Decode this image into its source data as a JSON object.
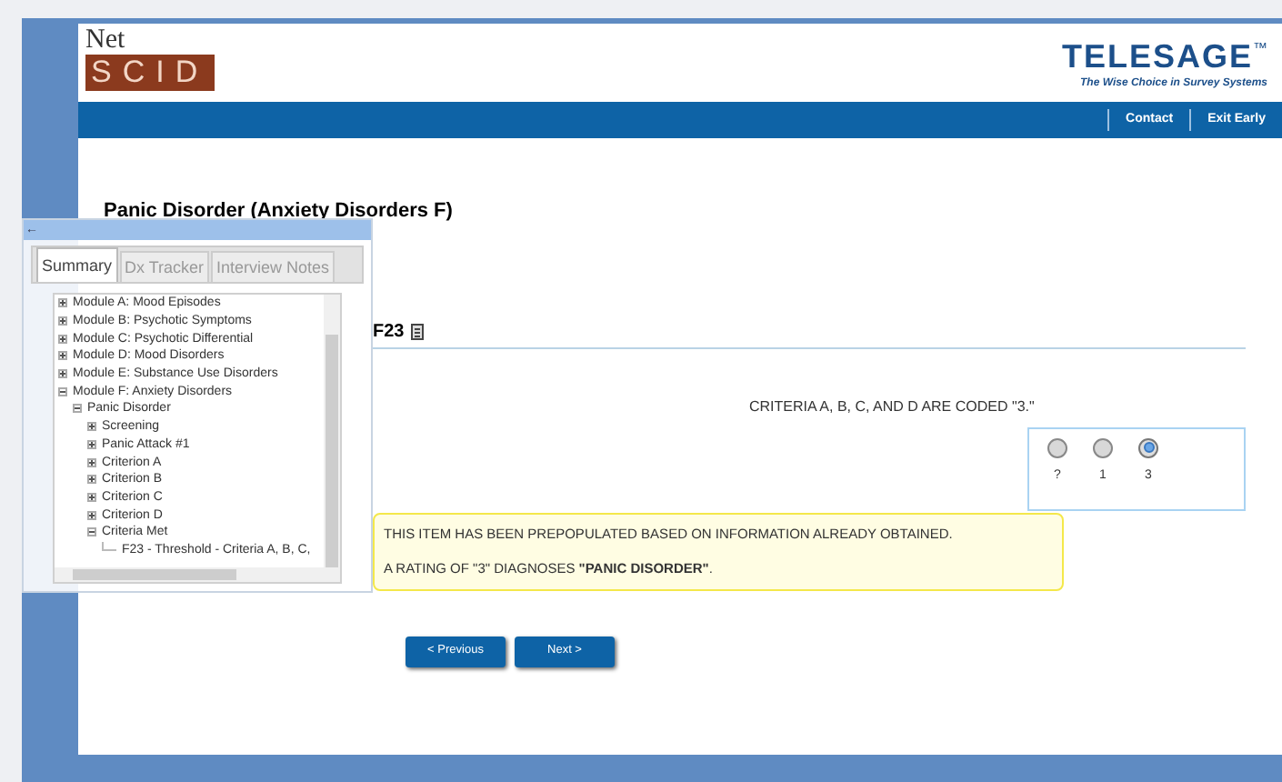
{
  "header": {
    "logo_top": "Net",
    "logo_bottom": "SCID",
    "brand": "TELESAGE",
    "brand_mark": "™",
    "tagline": "The Wise Choice in Survey Systems"
  },
  "nav": [
    "Contact",
    "Exit Early"
  ],
  "page_title": "Panic Disorder (Anxiety Disorders F)",
  "panel": {
    "back": "←",
    "tabs": [
      {
        "label": "Summary",
        "selected": true
      },
      {
        "label": "Dx Tracker",
        "selected": false
      },
      {
        "label": "Interview Notes",
        "selected": false
      }
    ],
    "tree": [
      {
        "label": "Module A: Mood Episodes",
        "expanded": false
      },
      {
        "label": "Module B: Psychotic Symptoms",
        "expanded": false
      },
      {
        "label": "Module C: Psychotic Differential",
        "expanded": false
      },
      {
        "label": "Module D: Mood Disorders",
        "expanded": false
      },
      {
        "label": "Module E: Substance Use Disorders",
        "expanded": false
      },
      {
        "label": "Module F: Anxiety Disorders",
        "expanded": true,
        "children": [
          {
            "label": "Panic Disorder",
            "expanded": true,
            "children": [
              {
                "label": "Screening",
                "expanded": false
              },
              {
                "label": "Panic Attack #1",
                "expanded": false
              },
              {
                "label": "Criterion A",
                "expanded": false
              },
              {
                "label": "Criterion B",
                "expanded": false
              },
              {
                "label": "Criterion C",
                "expanded": false
              },
              {
                "label": "Criterion D",
                "expanded": false
              },
              {
                "label": "Criteria Met",
                "expanded": true,
                "children": [
                  {
                    "label": "F23 - Threshold - Criteria A, B, C,"
                  }
                ]
              }
            ]
          }
        ]
      }
    ]
  },
  "item": {
    "code": "F23",
    "question": "CRITERIA A, B, C, AND D ARE CODED \"3.\"",
    "options": [
      {
        "label": "?",
        "selected": false
      },
      {
        "label": "1",
        "selected": false
      },
      {
        "label": "3",
        "selected": true
      }
    ],
    "notes": [
      "THIS ITEM HAS BEEN PREPOPULATED BASED ON INFORMATION ALREADY OBTAINED.",
      "A RATING OF \"3\" DIAGNOSES **\"PANIC DISORDER\"**."
    ]
  },
  "buttons": [
    "< Previous",
    "Next >"
  ]
}
